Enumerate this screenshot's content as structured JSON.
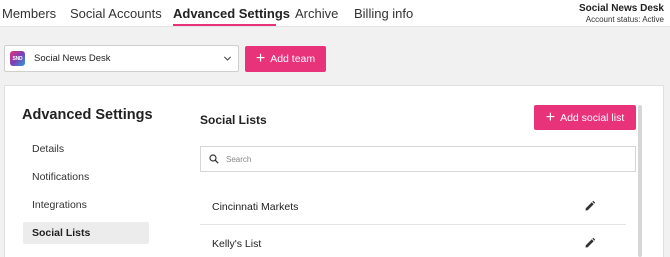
{
  "nav": {
    "tabs": [
      "Members",
      "Social Accounts",
      "Advanced Settings",
      "Archive",
      "Billing info"
    ],
    "active_tab": "Advanced Settings"
  },
  "account": {
    "name": "Social News Desk",
    "status": "Account status: Active"
  },
  "team_select": {
    "logo_text": "SND",
    "value": "Social News Desk"
  },
  "add_team_label": "Add team",
  "panel": {
    "title": "Advanced Settings",
    "sidebar": [
      "Details",
      "Notifications",
      "Integrations",
      "Social Lists"
    ],
    "active_item": "Social Lists"
  },
  "social_lists": {
    "title": "Social Lists",
    "add_label": "Add social list",
    "search_placeholder": "Search",
    "items": [
      "Cincinnati Markets",
      "Kelly's List"
    ]
  },
  "colors": {
    "accent": "#e8327a"
  }
}
